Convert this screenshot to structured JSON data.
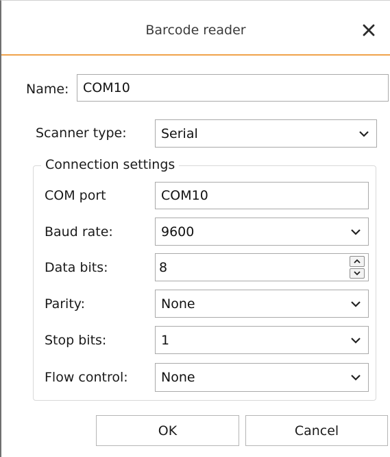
{
  "dialog": {
    "title": "Barcode reader",
    "close_icon": "close-icon"
  },
  "name_field": {
    "label": "Name:",
    "value": "COM10"
  },
  "scanner_type": {
    "label": "Scanner type:",
    "value": "Serial"
  },
  "connection_settings": {
    "title": "Connection settings",
    "com_port": {
      "label": "COM port",
      "value": "COM10"
    },
    "baud_rate": {
      "label": "Baud rate:",
      "value": "9600"
    },
    "data_bits": {
      "label": "Data bits:",
      "value": "8"
    },
    "parity": {
      "label": "Parity:",
      "value": "None"
    },
    "stop_bits": {
      "label": "Stop bits:",
      "value": "1"
    },
    "flow_control": {
      "label": "Flow control:",
      "value": "None"
    }
  },
  "buttons": {
    "ok": "OK",
    "cancel": "Cancel"
  },
  "colors": {
    "title_accent": "#f0a24a",
    "field_border": "#a9a9a9",
    "group_border": "#d8d8d8"
  }
}
